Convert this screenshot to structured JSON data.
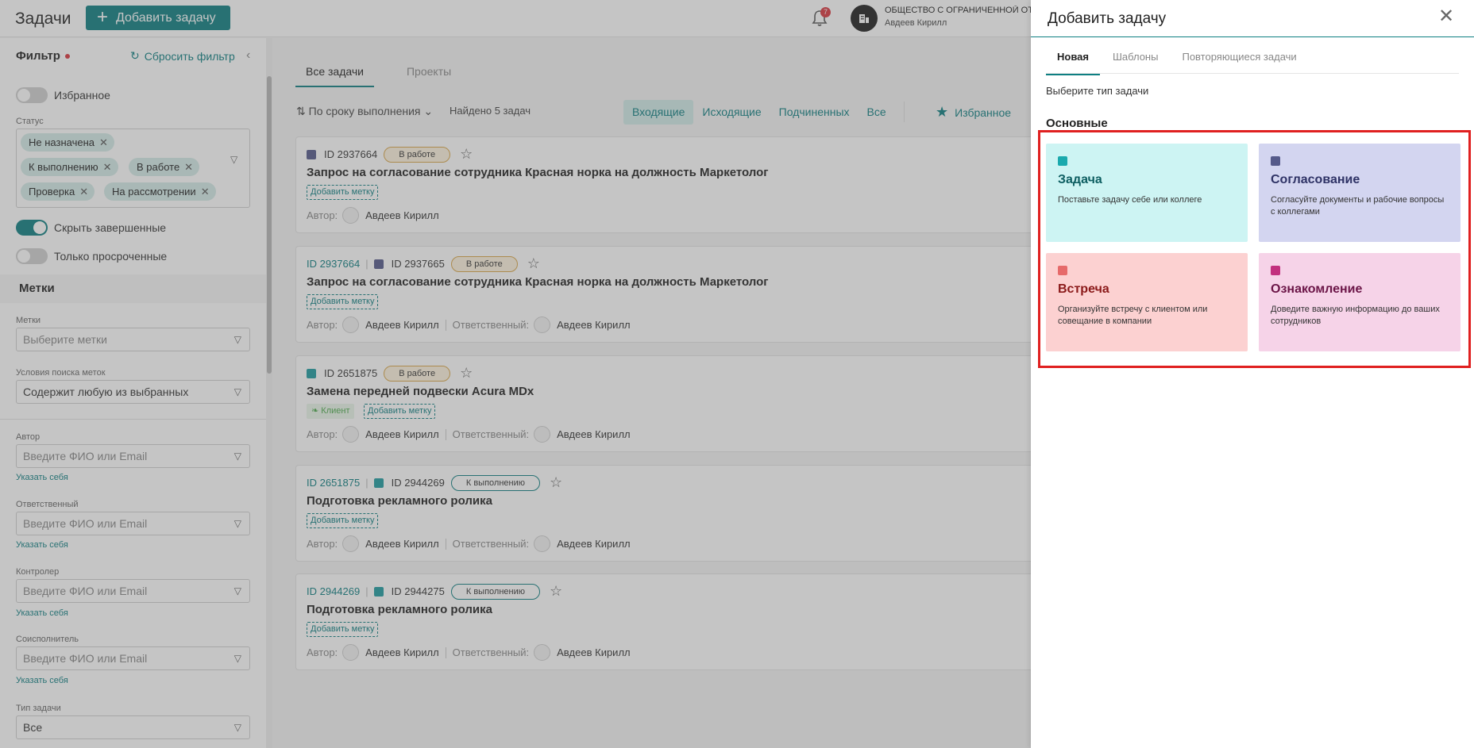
{
  "header": {
    "app_title": "Задачи",
    "add_task_label": "Добавить задачу",
    "notifications_count": "7",
    "org_name": "ОБЩЕСТВО С ОГРАНИЧЕННОЙ ОТВ",
    "user_name": "Авдеев Кирилл"
  },
  "filter": {
    "title": "Фильтр",
    "reset_label": "Сбросить фильтр",
    "favorites_label": "Избранное",
    "status_label": "Статус",
    "status_chips": [
      "Не назначена",
      "К выполнению",
      "В работе",
      "Проверка",
      "На рассмотрении"
    ],
    "hide_completed_label": "Скрыть завершенные",
    "overdue_only_label": "Только просроченные",
    "tags_section": "Метки",
    "tags_label": "Метки",
    "tags_placeholder": "Выберите метки",
    "tag_condition_label": "Условия поиска меток",
    "tag_condition_value": "Содержит любую из выбранных",
    "author_label": "Автор",
    "responsible_label": "Ответственный",
    "controller_label": "Контролер",
    "coexecutor_label": "Соисполнитель",
    "person_placeholder": "Введите ФИО или Email",
    "self_link": "Указать себя",
    "task_type_label": "Тип задачи",
    "task_type_value": "Все"
  },
  "main": {
    "tabs": [
      "Все задачи",
      "Проекты"
    ],
    "sort_label": "По сроку выполнения",
    "found_label": "Найдено 5 задач",
    "segments": [
      "Входящие",
      "Исходящие",
      "Подчиненных",
      "Все"
    ],
    "favorites_label": "Избранное",
    "author_prefix": "Автор:",
    "responsible_prefix": "Ответственный:",
    "add_tag_label": "Добавить метку",
    "cards": [
      {
        "parent_id": "",
        "id": "ID 2937664",
        "status": "В работе",
        "title": "Запрос на согласование сотрудника Красная норка на должность Маркетолог",
        "client_tag": "",
        "author": "Авдеев Кирилл",
        "responsible": ""
      },
      {
        "parent_id": "ID 2937664",
        "id": "ID 2937665",
        "status": "В работе",
        "title": "Запрос на согласование сотрудника Красная норка на должность Маркетолог",
        "client_tag": "",
        "author": "Авдеев Кирилл",
        "responsible": "Авдеев Кирилл"
      },
      {
        "parent_id": "",
        "id": "ID 2651875",
        "status": "В работе",
        "title": "Замена передней подвески Acura MDx",
        "client_tag": "Клиент",
        "author": "Авдеев Кирилл",
        "responsible": "Авдеев Кирилл"
      },
      {
        "parent_id": "ID 2651875",
        "id": "ID 2944269",
        "status": "К выполнению",
        "title": "Подготовка рекламного ролика",
        "client_tag": "",
        "author": "Авдеев Кирилл",
        "responsible": "Авдеев Кирилл"
      },
      {
        "parent_id": "ID 2944269",
        "id": "ID 2944275",
        "status": "К выполнению",
        "title": "Подготовка рекламного ролика",
        "client_tag": "",
        "author": "Авдеев Кирилл",
        "responsible": "Авдеев Кирилл"
      }
    ]
  },
  "drawer": {
    "title": "Добавить задачу",
    "tabs": [
      "Новая",
      "Шаблоны",
      "Повторяющиеся задачи"
    ],
    "hint": "Выберите тип задачи",
    "section": "Основные",
    "types": [
      {
        "name": "Задача",
        "desc": "Поставьте задачу себе или коллеге",
        "bg": "#cdf4f3",
        "accent": "#1aa9ad",
        "title_color": "#0d5e61"
      },
      {
        "name": "Согласование",
        "desc": "Согласуйте документы и рабочие вопросы с коллегами",
        "bg": "#d3d5f0",
        "accent": "#555a8a",
        "title_color": "#2f3366"
      },
      {
        "name": "Встреча",
        "desc": "Организуйте встречу с клиентом или совещание в компании",
        "bg": "#fcd1d1",
        "accent": "#e66a6a",
        "title_color": "#8b1a1a"
      },
      {
        "name": "Ознакомление",
        "desc": "Доведите важную информацию до ваших сотрудников",
        "bg": "#f6d3e8",
        "accent": "#c2307e",
        "title_color": "#6b1547"
      }
    ]
  }
}
